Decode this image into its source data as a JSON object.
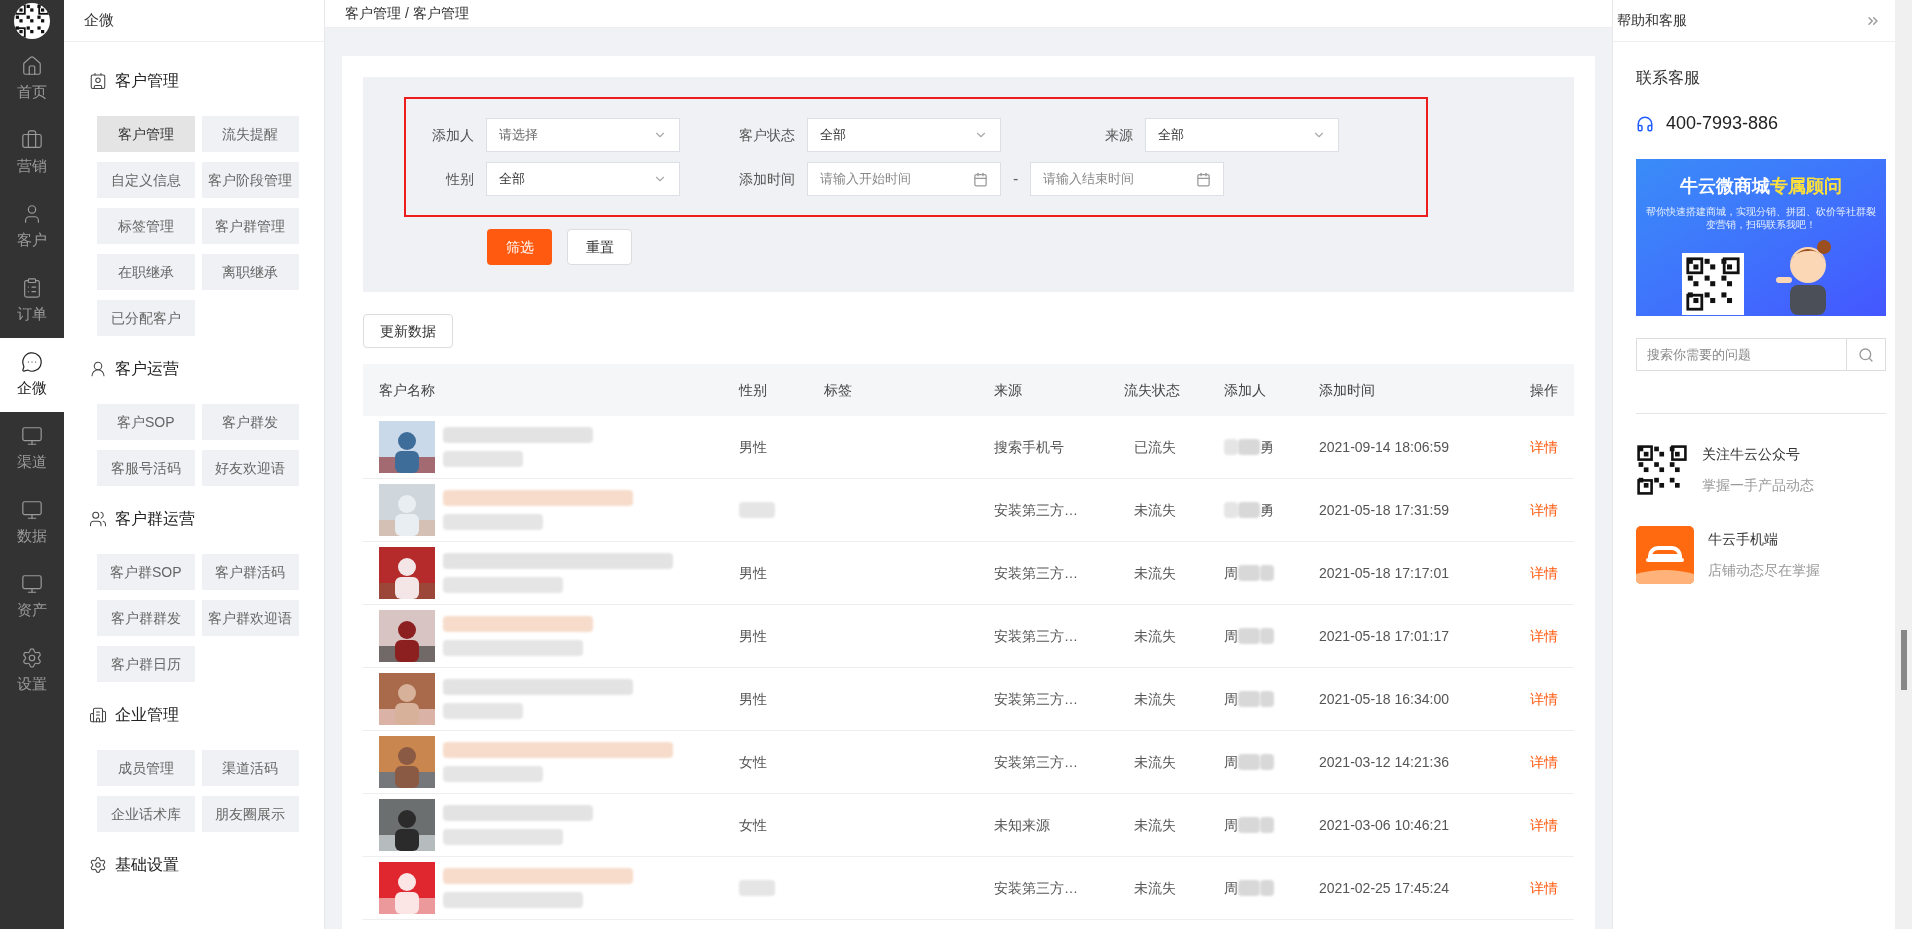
{
  "nav": {
    "items": [
      {
        "label": "首页",
        "kind": "home",
        "selected": false
      },
      {
        "label": "营销",
        "kind": "briefcase",
        "selected": false
      },
      {
        "label": "客户",
        "kind": "user",
        "selected": false
      },
      {
        "label": "订单",
        "kind": "order",
        "selected": false
      },
      {
        "label": "企微",
        "kind": "chat",
        "selected": true
      },
      {
        "label": "渠道",
        "kind": "monitor",
        "selected": false
      },
      {
        "label": "数据",
        "kind": "monitor",
        "selected": false
      },
      {
        "label": "资产",
        "kind": "monitor",
        "selected": false
      },
      {
        "label": "设置",
        "kind": "gear",
        "selected": false
      }
    ]
  },
  "submenu": {
    "title": "企微",
    "sections": [
      {
        "title": "客户管理",
        "kind": "contact",
        "items": [
          {
            "label": "客户管理",
            "selected": true
          },
          {
            "label": "流失提醒",
            "selected": false
          },
          {
            "label": "自定义信息",
            "selected": false
          },
          {
            "label": "客户阶段管理",
            "selected": false
          },
          {
            "label": "标签管理",
            "selected": false
          },
          {
            "label": "客户群管理",
            "selected": false
          },
          {
            "label": "在职继承",
            "selected": false
          },
          {
            "label": "离职继承",
            "selected": false
          },
          {
            "label": "已分配客户",
            "selected": false
          }
        ]
      },
      {
        "title": "客户运营",
        "kind": "person-chart",
        "items": [
          {
            "label": "客户SOP",
            "selected": false
          },
          {
            "label": "客户群发",
            "selected": false
          },
          {
            "label": "客服号活码",
            "selected": false
          },
          {
            "label": "好友欢迎语",
            "selected": false
          }
        ]
      },
      {
        "title": "客户群运营",
        "kind": "group",
        "items": [
          {
            "label": "客户群SOP",
            "selected": false
          },
          {
            "label": "客户群活码",
            "selected": false
          },
          {
            "label": "客户群群发",
            "selected": false
          },
          {
            "label": "客户群欢迎语",
            "selected": false
          },
          {
            "label": "客户群日历",
            "selected": false
          }
        ]
      },
      {
        "title": "企业管理",
        "kind": "company",
        "items": [
          {
            "label": "成员管理",
            "selected": false
          },
          {
            "label": "渠道活码",
            "selected": false
          },
          {
            "label": "企业话术库",
            "selected": false
          },
          {
            "label": "朋友圈展示",
            "selected": false
          }
        ]
      },
      {
        "title": "基础设置",
        "kind": "gear"
      }
    ]
  },
  "breadcrumb": "客户管理 / 客户管理",
  "filters": [
    {
      "label": "添加人",
      "kind": "select",
      "placeholder": "请选择"
    },
    {
      "label": "客户状态",
      "kind": "select",
      "value": "全部"
    },
    {
      "label": "来源",
      "kind": "select",
      "value": "全部"
    },
    {
      "label": "性别",
      "kind": "select",
      "value": "全部"
    },
    {
      "label": "添加时间",
      "kind": "date-range",
      "start_placeholder": "请输入开始时间",
      "separator": "-",
      "end_placeholder": "请输入结束时间"
    }
  ],
  "filter_button": "筛选",
  "reset_button": "重置",
  "refresh_button": "更新数据",
  "table": {
    "columns": [
      "客户名称",
      "性别",
      "标签",
      "来源",
      "流失状态",
      "添加人",
      "添加时间",
      "操作"
    ],
    "rows": [
      {
        "gender": "男性",
        "source": "搜索手机号",
        "status": "已流失",
        "adder_end": "勇",
        "time": "2021-09-14 18:06:59",
        "action": "详情"
      },
      {
        "source": "安装第三方…",
        "status": "未流失",
        "adder_end": "勇",
        "time": "2021-05-18 17:31:59",
        "action": "详情"
      },
      {
        "gender": "男性",
        "source": "安装第三方…",
        "status": "未流失",
        "adder_start": "周",
        "time": "2021-05-18 17:17:01",
        "action": "详情"
      },
      {
        "gender": "男性",
        "source": "安装第三方…",
        "status": "未流失",
        "adder_start": "周",
        "time": "2021-05-18 17:01:17",
        "action": "详情"
      },
      {
        "gender": "男性",
        "source": "安装第三方…",
        "status": "未流失",
        "adder_start": "周",
        "time": "2021-05-18 16:34:00",
        "action": "详情"
      },
      {
        "gender": "女性",
        "source": "安装第三方…",
        "status": "未流失",
        "adder_start": "周",
        "time": "2021-03-12 14:21:36",
        "action": "详情"
      },
      {
        "gender": "女性",
        "source": "未知来源",
        "status": "未流失",
        "adder_start": "周",
        "time": "2021-03-06 10:46:21",
        "action": "详情"
      },
      {
        "source": "安装第三方…",
        "status": "未流失",
        "adder_start": "周",
        "time": "2021-02-25 17:45:24",
        "action": "详情"
      }
    ]
  },
  "help": {
    "title": "帮助和客服",
    "contact_title": "联系客服",
    "phone": "400-7993-886",
    "banner": {
      "title": "牛云微商城",
      "title_highlight": "专属顾问",
      "text": "帮你快速搭建商城，实现分销、拼团、砍价等社群裂变营销，扫码联系我吧！"
    },
    "search_placeholder": "搜索你需要的问题",
    "promos": [
      {
        "kind": "qr",
        "title": "关注牛云公众号",
        "subtitle": "掌握一手产品动态"
      },
      {
        "kind": "app",
        "title": "牛云手机端",
        "subtitle": "店铺动态尽在掌握"
      }
    ]
  }
}
